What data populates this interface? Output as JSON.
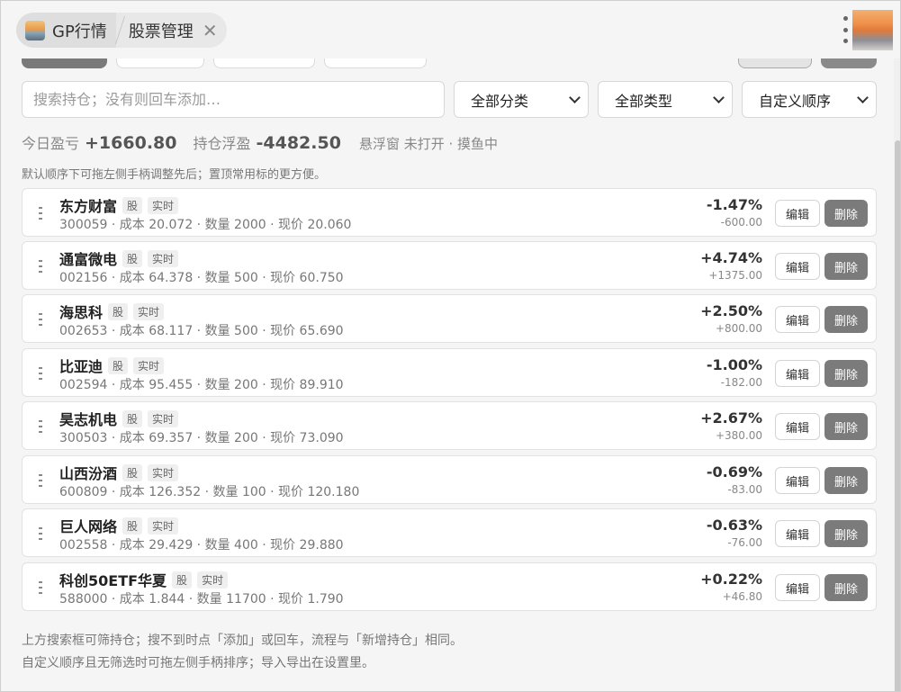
{
  "tabs": [
    {
      "label": "GP行情",
      "icon": "app-icon"
    },
    {
      "label": "股票管理",
      "icon": "close-icon"
    }
  ],
  "search": {
    "placeholder": "搜索持仓；没有则回车添加…"
  },
  "filters": {
    "category": "全部分类",
    "type": "全部类型",
    "order": "自定义顺序"
  },
  "summary": {
    "today_label": "今日盈亏",
    "today_value": "+1660.80",
    "float_label": "持仓浮盈",
    "float_value": "-4482.50",
    "status": "悬浮窗 未打开 · 摸鱼中"
  },
  "hint": "默认顺序下可拖左侧手柄调整先后；置顶常用标的更方便。",
  "buttons": {
    "edit": "编辑",
    "delete": "删除"
  },
  "holdings": [
    {
      "name": "东方财富",
      "badge1": "股",
      "badge2": "实时",
      "meta": "300059 · 成本 20.072 · 数量 2000 · 现价 20.060",
      "pct": "-1.47%",
      "amount": "-600.00"
    },
    {
      "name": "通富微电",
      "badge1": "股",
      "badge2": "实时",
      "meta": "002156 · 成本 64.378 · 数量 500 · 现价 60.750",
      "pct": "+4.74%",
      "amount": "+1375.00"
    },
    {
      "name": "海思科",
      "badge1": "股",
      "badge2": "实时",
      "meta": "002653 · 成本 68.117 · 数量 500 · 现价 65.690",
      "pct": "+2.50%",
      "amount": "+800.00"
    },
    {
      "name": "比亚迪",
      "badge1": "股",
      "badge2": "实时",
      "meta": "002594 · 成本 95.455 · 数量 200 · 现价 89.910",
      "pct": "-1.00%",
      "amount": "-182.00"
    },
    {
      "name": "昊志机电",
      "badge1": "股",
      "badge2": "实时",
      "meta": "300503 · 成本 69.357 · 数量 200 · 现价 73.090",
      "pct": "+2.67%",
      "amount": "+380.00"
    },
    {
      "name": "山西汾酒",
      "badge1": "股",
      "badge2": "实时",
      "meta": "600809 · 成本 126.352 · 数量 100 · 现价 120.180",
      "pct": "-0.69%",
      "amount": "-83.00"
    },
    {
      "name": "巨人网络",
      "badge1": "股",
      "badge2": "实时",
      "meta": "002558 · 成本 29.429 · 数量 400 · 现价 29.880",
      "pct": "-0.63%",
      "amount": "-76.00"
    },
    {
      "name": "科创50ETF华夏",
      "badge1": "股",
      "badge2": "实时",
      "meta": "588000 · 成本 1.844 · 数量 11700 · 现价 1.790",
      "pct": "+0.22%",
      "amount": "+46.80"
    }
  ],
  "footer": {
    "line1": "上方搜索框可筛持仓；搜不到时点「添加」或回车，流程与「新增持仓」相同。",
    "line2": "自定义顺序且无筛选时可拖左侧手柄排序；导入导出在设置里。"
  }
}
